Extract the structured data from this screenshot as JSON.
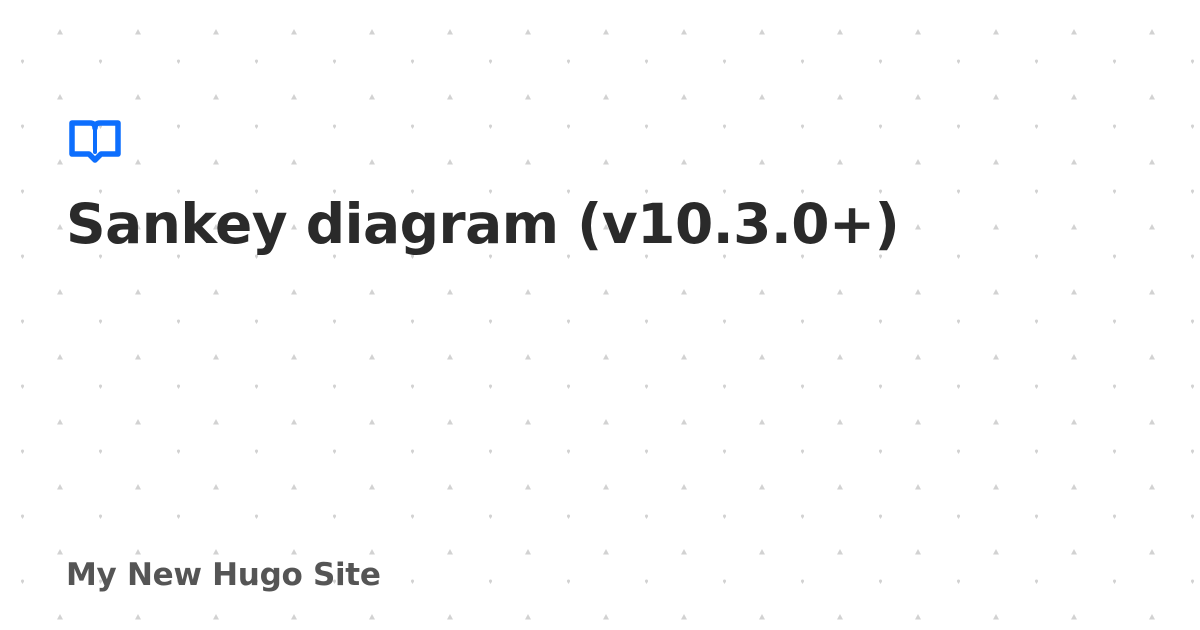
{
  "page": {
    "title": "Sankey diagram (v10.3.0+)",
    "site_name": "My New Hugo Site"
  },
  "logo": {
    "icon": "book-icon",
    "color": "#0d6efd"
  },
  "colors": {
    "title": "#2a2a2a",
    "site_name": "#555555",
    "background": "#ffffff",
    "pattern": "#cfcfcf"
  }
}
